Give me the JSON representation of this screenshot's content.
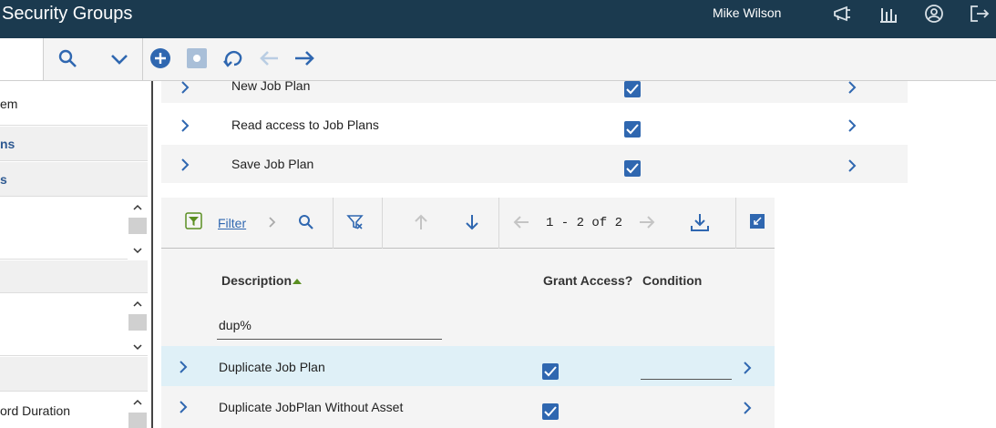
{
  "header": {
    "title": "Security Groups",
    "user": "Mike Wilson",
    "icons": [
      "megaphone-icon",
      "bar-chart-icon",
      "user-profile-icon",
      "logout-icon"
    ]
  },
  "toolbar": {
    "icons": [
      "search-icon",
      "chevron-down-icon",
      "add-icon",
      "save-icon",
      "undo-icon",
      "previous-icon",
      "next-icon"
    ]
  },
  "left_panel": {
    "row1": "em",
    "row2": "ns",
    "row3": "s",
    "row_last": "ord Duration"
  },
  "upper_rows": [
    {
      "label": "New Job Plan",
      "granted": true
    },
    {
      "label": "Read access to Job Plans",
      "granted": true
    },
    {
      "label": "Save Job Plan",
      "granted": true
    }
  ],
  "table": {
    "filter_label": "Filter",
    "pagination": "1 - 2 of 2",
    "columns": {
      "description": "Description",
      "grant_access": "Grant Access?",
      "condition": "Condition"
    },
    "description_filter_value": "dup%",
    "rows": [
      {
        "description": "Duplicate Job Plan",
        "granted": true,
        "condition": ""
      },
      {
        "description": "Duplicate JobPlan Without Asset",
        "granted": true,
        "condition": ""
      }
    ]
  },
  "colors": {
    "header_bg": "#1b3a4f",
    "accent_blue": "#2f67b0",
    "selected_row": "#dff0f7",
    "filter_green": "#5a8e21"
  }
}
